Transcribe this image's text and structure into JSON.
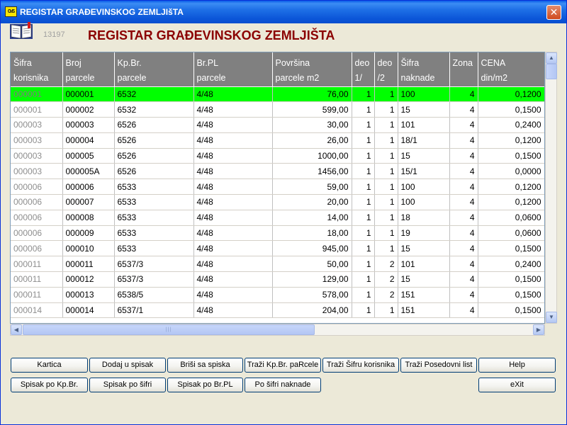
{
  "window": {
    "title": "REGISTAR GRAĐEVINSKOG ZEMLJIšTA",
    "app_icon_label": "CWS",
    "close_label": "✕"
  },
  "header": {
    "record_number": "13197",
    "title": "REGISTAR GRAĐEVINSKOG ZEMLJIŠTA"
  },
  "grid": {
    "columns": [
      {
        "line1": "Šifra",
        "line2": "korisnika"
      },
      {
        "line1": "Broj",
        "line2": "parcele"
      },
      {
        "line1": "Kp.Br.",
        "line2": "parcele"
      },
      {
        "line1": "Br.PL",
        "line2": "parcele"
      },
      {
        "line1": "Površina",
        "line2": "parcele m2"
      },
      {
        "line1": "deo",
        "line2": "1/"
      },
      {
        "line1": "deo",
        "line2": "/2"
      },
      {
        "line1": "Šifra",
        "line2": "naknade"
      },
      {
        "line1": "Zona",
        "line2": ""
      },
      {
        "line1": "CENA",
        "line2": "din/m2"
      }
    ],
    "rows": [
      [
        "000001",
        "000001",
        "6532",
        "4/48",
        "76,00",
        "1",
        "1",
        "100",
        "4",
        "0,1200"
      ],
      [
        "000001",
        "000002",
        "6532",
        "4/48",
        "599,00",
        "1",
        "1",
        "15",
        "4",
        "0,1500"
      ],
      [
        "000003",
        "000003",
        "6526",
        "4/48",
        "30,00",
        "1",
        "1",
        "101",
        "4",
        "0,2400"
      ],
      [
        "000003",
        "000004",
        "6526",
        "4/48",
        "26,00",
        "1",
        "1",
        "18/1",
        "4",
        "0,1200"
      ],
      [
        "000003",
        "000005",
        "6526",
        "4/48",
        "1000,00",
        "1",
        "1",
        "15",
        "4",
        "0,1500"
      ],
      [
        "000003",
        "000005A",
        "6526",
        "4/48",
        "1456,00",
        "1",
        "1",
        "15/1",
        "4",
        "0,0000"
      ],
      [
        "000006",
        "000006",
        "6533",
        "4/48",
        "59,00",
        "1",
        "1",
        "100",
        "4",
        "0,1200"
      ],
      [
        "000006",
        "000007",
        "6533",
        "4/48",
        "20,00",
        "1",
        "1",
        "100",
        "4",
        "0,1200"
      ],
      [
        "000006",
        "000008",
        "6533",
        "4/48",
        "14,00",
        "1",
        "1",
        "18",
        "4",
        "0,0600"
      ],
      [
        "000006",
        "000009",
        "6533",
        "4/48",
        "18,00",
        "1",
        "1",
        "19",
        "4",
        "0,0600"
      ],
      [
        "000006",
        "000010",
        "6533",
        "4/48",
        "945,00",
        "1",
        "1",
        "15",
        "4",
        "0,1500"
      ],
      [
        "000011",
        "000011",
        "6537/3",
        "4/48",
        "50,00",
        "1",
        "2",
        "101",
        "4",
        "0,2400"
      ],
      [
        "000011",
        "000012",
        "6537/3",
        "4/48",
        "129,00",
        "1",
        "2",
        "15",
        "4",
        "0,1500"
      ],
      [
        "000011",
        "000013",
        "6538/5",
        "4/48",
        "578,00",
        "1",
        "2",
        "151",
        "4",
        "0,1500"
      ],
      [
        "000014",
        "000014",
        "6537/1",
        "4/48",
        "204,00",
        "1",
        "1",
        "151",
        "4",
        "0,1500"
      ]
    ],
    "selected_row": 0
  },
  "scrollbars": {
    "up": "▲",
    "down": "▼",
    "left": "◀",
    "right": "▶",
    "grip": "|||"
  },
  "buttons": {
    "kartica": "Kartica",
    "dodaj": "Dodaj u spisak",
    "brisi": "Briši sa spiska",
    "trazi_kp": "Traži Kp.Br. paRcele",
    "trazi_sifru": "Traži Šifru korisnika",
    "trazi_posedovni": "Traži Posedovni list",
    "help": "Help",
    "spisak_kp": "Spisak po Kp.Br.",
    "spisak_sifri": "Spisak po šifri",
    "spisak_brpl": "Spisak po Br.PL",
    "po_sifri_naknade": "Po šifri naknade",
    "exit": "eXit"
  }
}
